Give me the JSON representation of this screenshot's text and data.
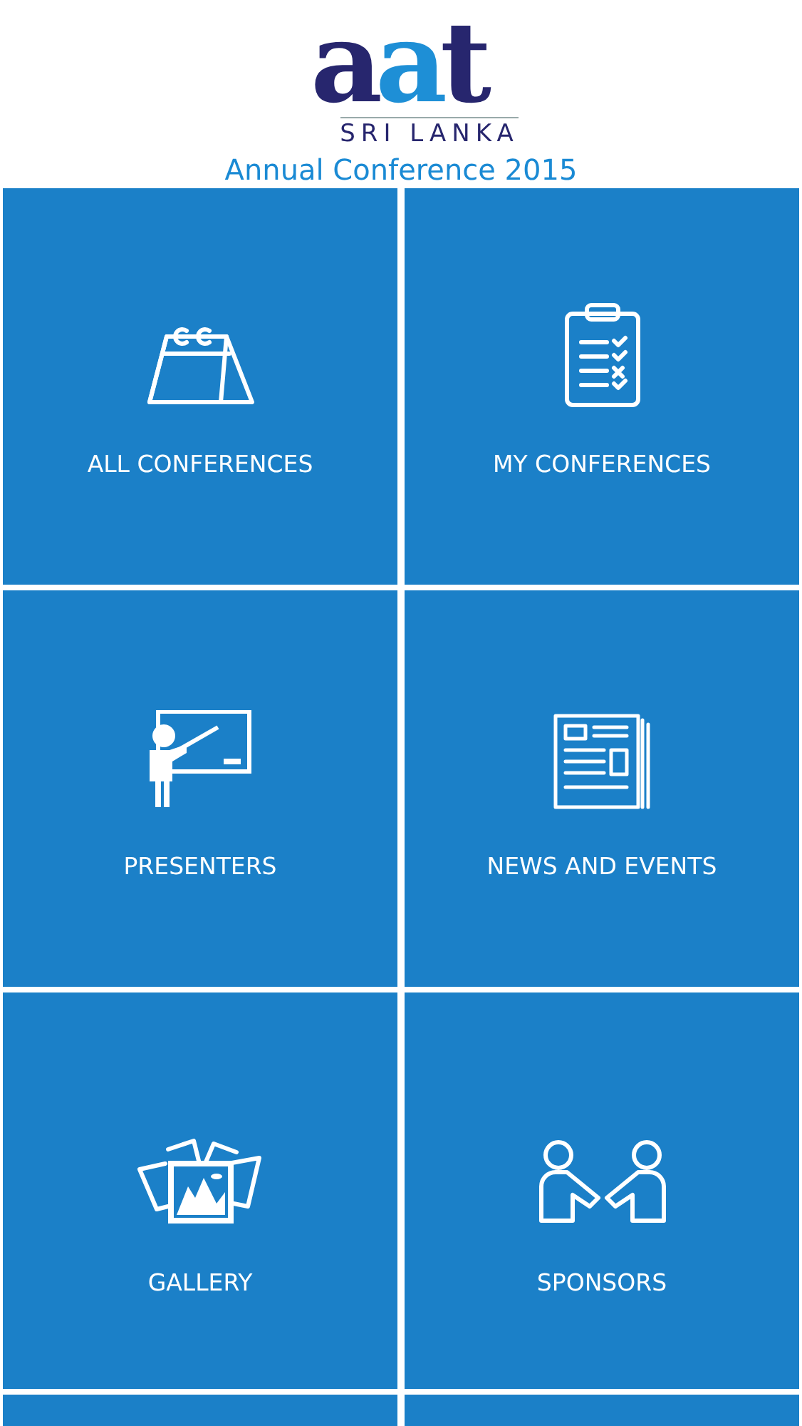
{
  "logo": {
    "wordmark": "aat",
    "subtitle": "SRI LANKA"
  },
  "title": "Annual Conference 2015",
  "tiles": [
    {
      "kind": "calendar",
      "label": "ALL CONFERENCES"
    },
    {
      "kind": "clipboard",
      "label": "MY CONFERENCES"
    },
    {
      "kind": "presenter",
      "label": "PRESENTERS"
    },
    {
      "kind": "newspaper",
      "label": "NEWS AND EVENTS"
    },
    {
      "kind": "photos",
      "label": "GALLERY"
    },
    {
      "kind": "handshake",
      "label": "SPONSORS"
    },
    {
      "kind": "partial"
    },
    {
      "kind": "partial"
    }
  ]
}
